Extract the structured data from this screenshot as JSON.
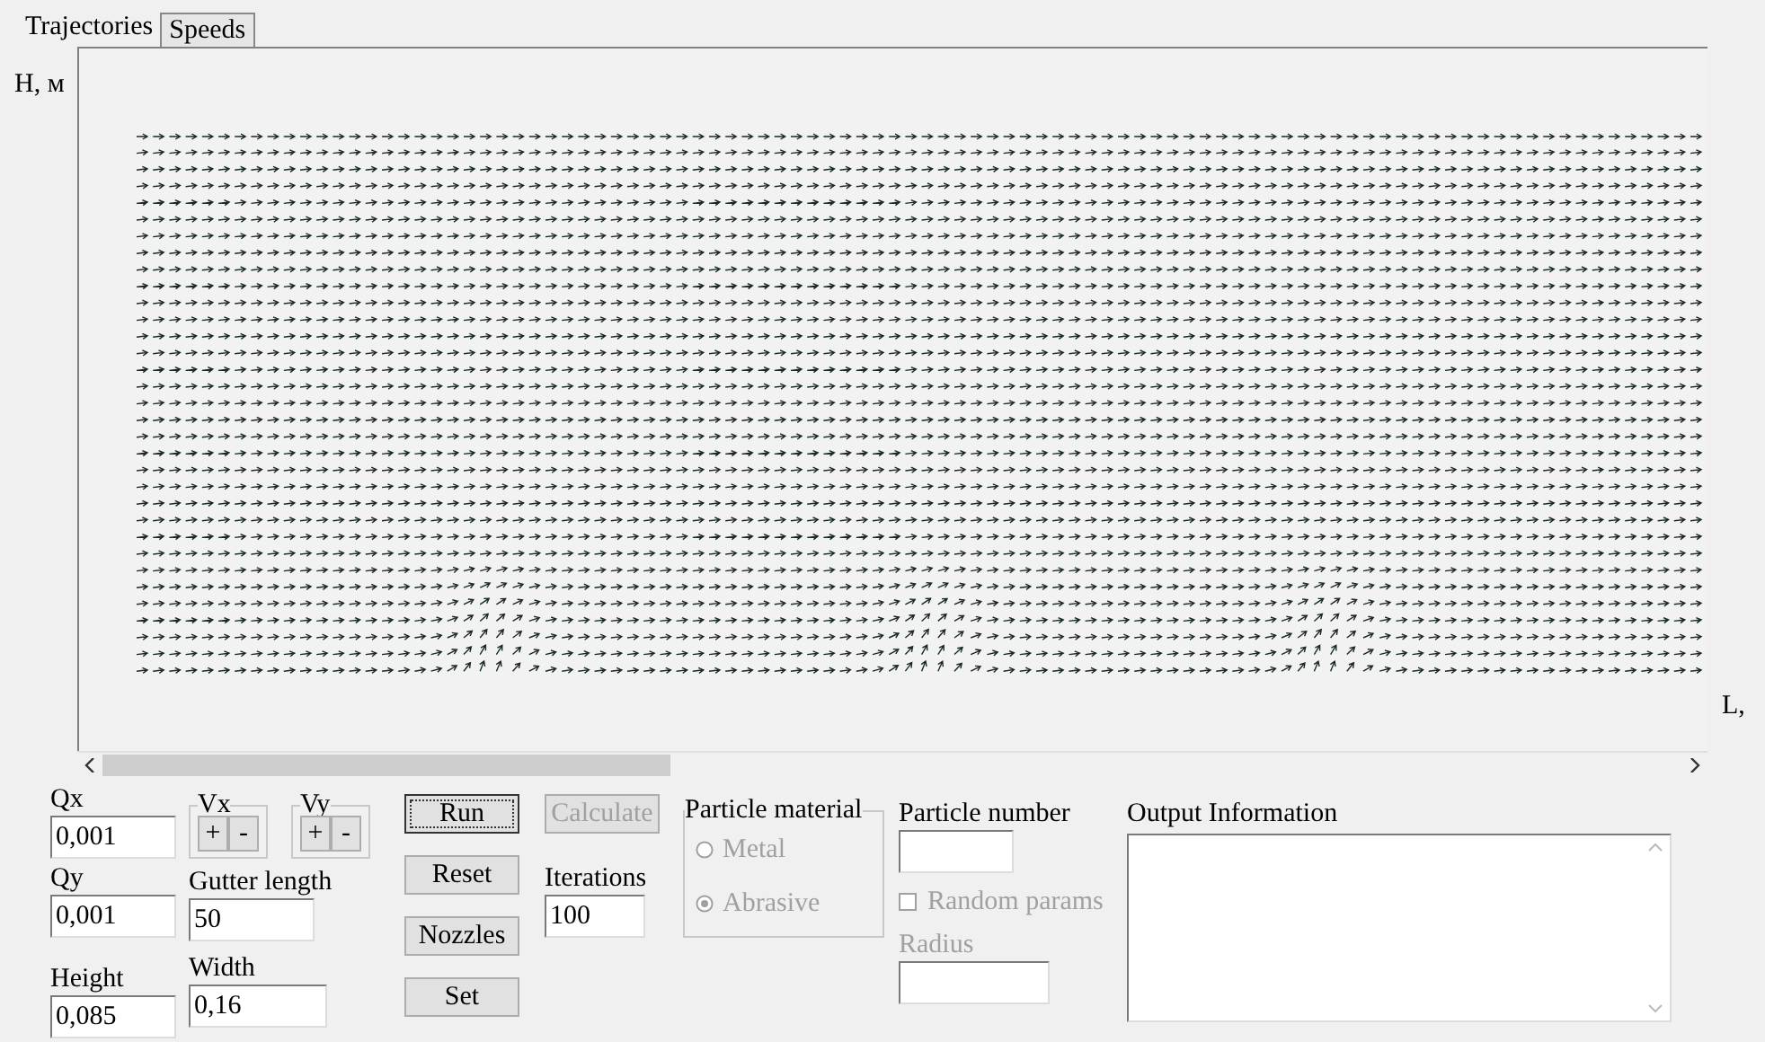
{
  "tabs": [
    {
      "label": "Trajectories",
      "selected": true
    },
    {
      "label": "Speeds",
      "selected": false
    }
  ],
  "plot": {
    "y_axis_label": "H, м",
    "x_axis_label": "L,"
  },
  "flow_inputs": [
    {
      "label": "Qx",
      "value": "0,001"
    },
    {
      "label": "Qy",
      "value": "0,001"
    }
  ],
  "height": {
    "label": "Height",
    "value": "0,085"
  },
  "steppers": [
    {
      "label": "Vx",
      "plus": "+",
      "minus": "-"
    },
    {
      "label": "Vy",
      "plus": "+",
      "minus": "-"
    }
  ],
  "gutter_length": {
    "label": "Gutter length",
    "value": "50"
  },
  "width": {
    "label": "Width",
    "value": "0,16"
  },
  "buttons": [
    {
      "label": "Run",
      "focused": true
    },
    {
      "label": "Reset",
      "focused": false
    },
    {
      "label": "Nozzles",
      "focused": false
    },
    {
      "label": "Set",
      "focused": false
    }
  ],
  "calculate": {
    "label": "Calculate",
    "disabled": true
  },
  "iterations": {
    "label": "Iterations",
    "value": "100"
  },
  "particle_material": {
    "label": "Particle material",
    "disabled": true,
    "options": [
      {
        "label": "Metal",
        "selected": false
      },
      {
        "label": "Abrasive",
        "selected": true
      }
    ]
  },
  "particle_number": {
    "label": "Particle number"
  },
  "random_params": {
    "label": "Random params",
    "checked": false,
    "disabled": true
  },
  "radius": {
    "label": "Radius",
    "disabled": true
  },
  "output": {
    "label": "Output Information"
  }
}
